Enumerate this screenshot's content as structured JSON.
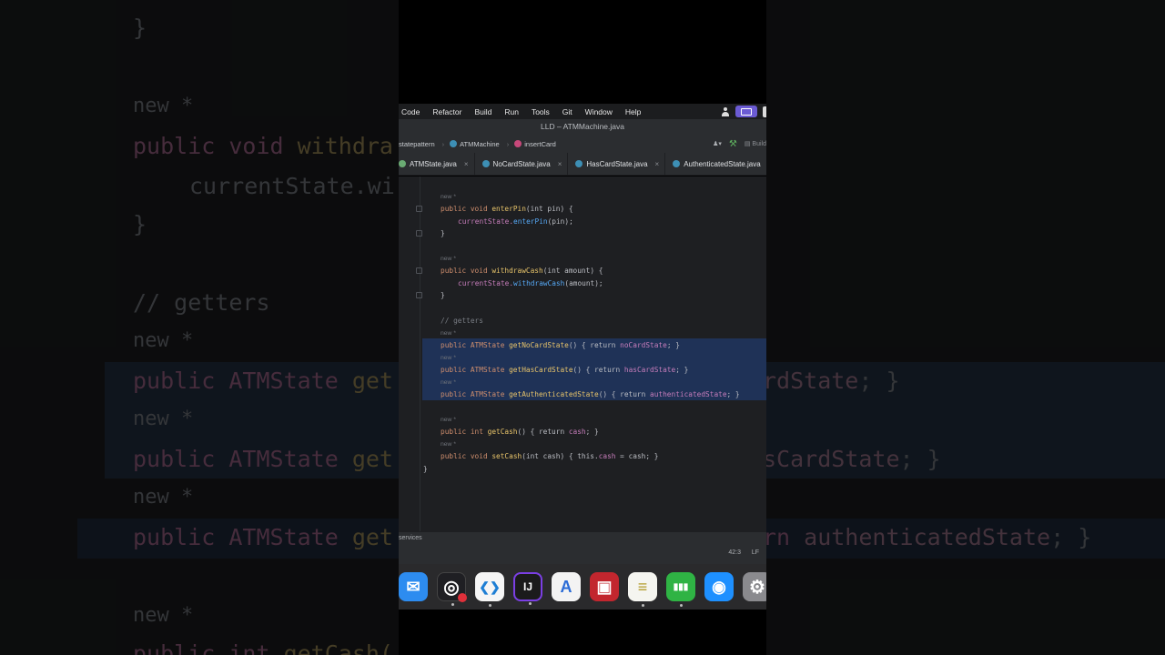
{
  "menu": {
    "items": [
      "Code",
      "Refactor",
      "Build",
      "Run",
      "Tools",
      "Git",
      "Window",
      "Help"
    ]
  },
  "window": {
    "title": "LLD – ATMMachine.java"
  },
  "breadcrumb": {
    "items": [
      {
        "label": "statepattern",
        "icon": "package-icon",
        "color": "#8b8e93"
      },
      {
        "label": "ATMMachine",
        "icon": "class-icon",
        "color": "#3d8fb5"
      },
      {
        "label": "insertCard",
        "icon": "method-icon",
        "color": "#c7487a"
      }
    ],
    "build_label": "Build"
  },
  "tabs": [
    {
      "label": "ATMState.java",
      "color": "#6aab73"
    },
    {
      "label": "NoCardState.java",
      "color": "#3d8fb5"
    },
    {
      "label": "HasCardState.java",
      "color": "#3d8fb5"
    },
    {
      "label": "AuthenticatedState.java",
      "color": "#3d8fb5"
    }
  ],
  "code": {
    "hint_new": "new *",
    "lines": {
      "enterPin_sig": [
        "public void ",
        "enterPin",
        "(int pin) {"
      ],
      "enterPin_body": [
        "currentState.",
        "enterPin",
        "(pin);"
      ],
      "close": "}",
      "withdraw_sig": [
        "public void ",
        "withdrawCash",
        "(int amount) {"
      ],
      "withdraw_body": [
        "currentState.",
        "withdrawCash",
        "(amount);"
      ],
      "comment": "// getters",
      "getNo": [
        "public ATMState ",
        "getNoCardState",
        "() { return ",
        "noCardState",
        "; }"
      ],
      "getHas": [
        "public ATMState ",
        "getHasCardState",
        "() { return ",
        "hasCardState",
        "; }"
      ],
      "getAuth": [
        "public ATMState ",
        "getAuthenticatedState",
        "() { return ",
        "authenticatedState",
        "; }"
      ],
      "getCash": [
        "public int ",
        "getCash",
        "() { return ",
        "cash",
        "; }"
      ],
      "setCash": [
        "public void ",
        "setCash",
        "(int cash) { this.",
        "cash",
        " = cash; }"
      ]
    }
  },
  "status": {
    "services_label": "services",
    "caret_position": "42:3",
    "line_ending": "LF"
  },
  "dock": {
    "apps": [
      {
        "name": "Mail",
        "icon": "mail-icon",
        "color": "#2d8cf0",
        "glyph": "✉",
        "running": false
      },
      {
        "name": "OBS",
        "icon": "obs-icon",
        "color": "#1f1f23",
        "glyph": "◎",
        "running": true
      },
      {
        "name": "VS Code",
        "icon": "vscode-icon",
        "color": "#1d7ed4",
        "glyph": "❮❯",
        "running": true
      },
      {
        "name": "IntelliJ",
        "icon": "intellij-icon",
        "color": "#1b1b1b",
        "glyph": "IJ",
        "running": true
      },
      {
        "name": "Android Studio",
        "icon": "android-studio-icon",
        "color": "#f3f3f3",
        "glyph": "A",
        "running": false
      },
      {
        "name": "Photo Booth",
        "icon": "photo-booth-icon",
        "color": "#c2262e",
        "glyph": "▣",
        "running": false
      },
      {
        "name": "Notes",
        "icon": "notes-icon",
        "color": "#f5f5f0",
        "glyph": "≡",
        "running": true
      },
      {
        "name": "Numbers",
        "icon": "numbers-icon",
        "color": "#2fb344",
        "glyph": "▮▮▮",
        "running": true
      },
      {
        "name": "Safari",
        "icon": "safari-icon",
        "color": "#1e90ff",
        "glyph": "◉",
        "running": false
      },
      {
        "name": "Settings",
        "icon": "settings-icon",
        "color": "#8a8a8e",
        "glyph": "⚙",
        "running": false
      }
    ]
  },
  "backdrop": {
    "lines": {
      "close1": "}",
      "new1": "new *",
      "withdraw_sig": [
        "public void ",
        "withdra"
      ],
      "withdraw_body": "currentState.wi",
      "close2": "}",
      "comment": "// getters",
      "new2": "new *",
      "get1": [
        "public ATMState ",
        "get"
      ],
      "get1_right": [
        "rdState",
        "; }"
      ],
      "new3": "new *",
      "get2": [
        "public ATMState ",
        "get"
      ],
      "get2_right": [
        "sCardState",
        "; }"
      ],
      "new4": "new *",
      "get3": [
        "public ATMState ",
        "get"
      ],
      "get3_right": [
        "rn ",
        "authenticatedState",
        "; }"
      ],
      "new5": "new *",
      "getcash": [
        "public int ",
        "getCash("
      ]
    }
  }
}
